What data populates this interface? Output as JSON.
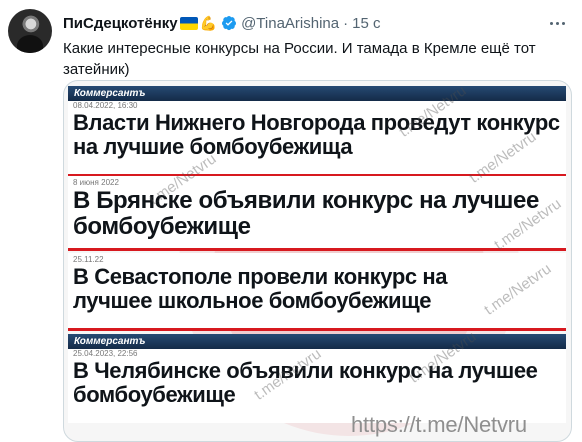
{
  "tweet": {
    "author": "ПиСдецкотёнку",
    "handle": "@TinaArishina",
    "separator": "·",
    "time": "15 с",
    "text": "Какие интересные конкурсы на России. И тамада в Кремле ещё тот затейник)",
    "icons": [
      "avatar",
      "ukraine-flag-icon",
      "flexed-biceps-icon",
      "verified-icon",
      "more-icon"
    ]
  },
  "media": {
    "cards": [
      {
        "brand": "Коммерсантъ",
        "date": "08.04.2022, 16:30",
        "headline": "Власти Нижнего Новгорода проведут конкурс\nна лучшие бомбоубежища"
      },
      {
        "brand": "",
        "date": "8 июня 2022",
        "headline": "В Брянске объявили конкурс на лучшее\nбомбоубежище"
      },
      {
        "brand": "",
        "date": "25.11.22",
        "headline": "В Севастополе провели конкурс на\nлучшее школьное бомбоубежище"
      },
      {
        "brand": "Коммерсантъ",
        "date": "25.04.2023, 22:56",
        "headline": "В Челябинске объявили конкурс на лучшее\nбомбоубежище"
      }
    ],
    "watermarks": [
      "t.me/Netvru",
      "t.me/Netvru",
      "t.me/Netvru",
      "t.me/Netvru",
      "t.me/Netvru",
      "t.me/Netvru",
      "t.me/Netvru"
    ],
    "url_watermark": "https://t.me/Netvru",
    "colors": {
      "accent_red": "#d7191f",
      "brand_blue": "#264a73",
      "verified_blue": "#1d9bf0"
    }
  }
}
